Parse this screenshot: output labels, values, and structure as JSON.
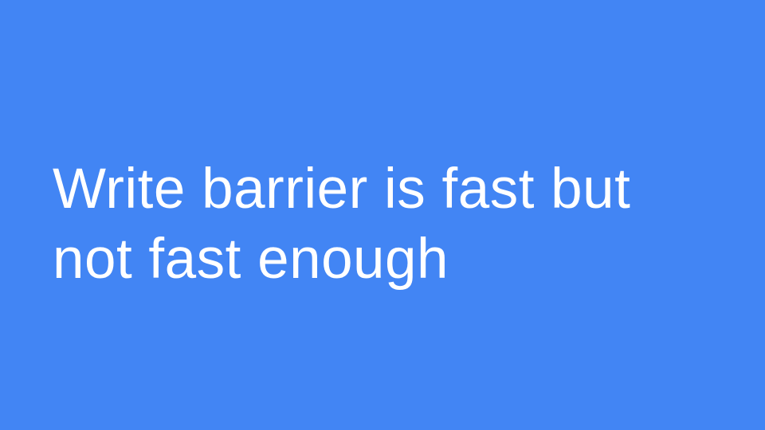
{
  "slide": {
    "background_color": "#4285f4",
    "text_color": "#ffffff",
    "title_lines": [
      "Write barrier is fast but",
      "not fast enough"
    ]
  }
}
